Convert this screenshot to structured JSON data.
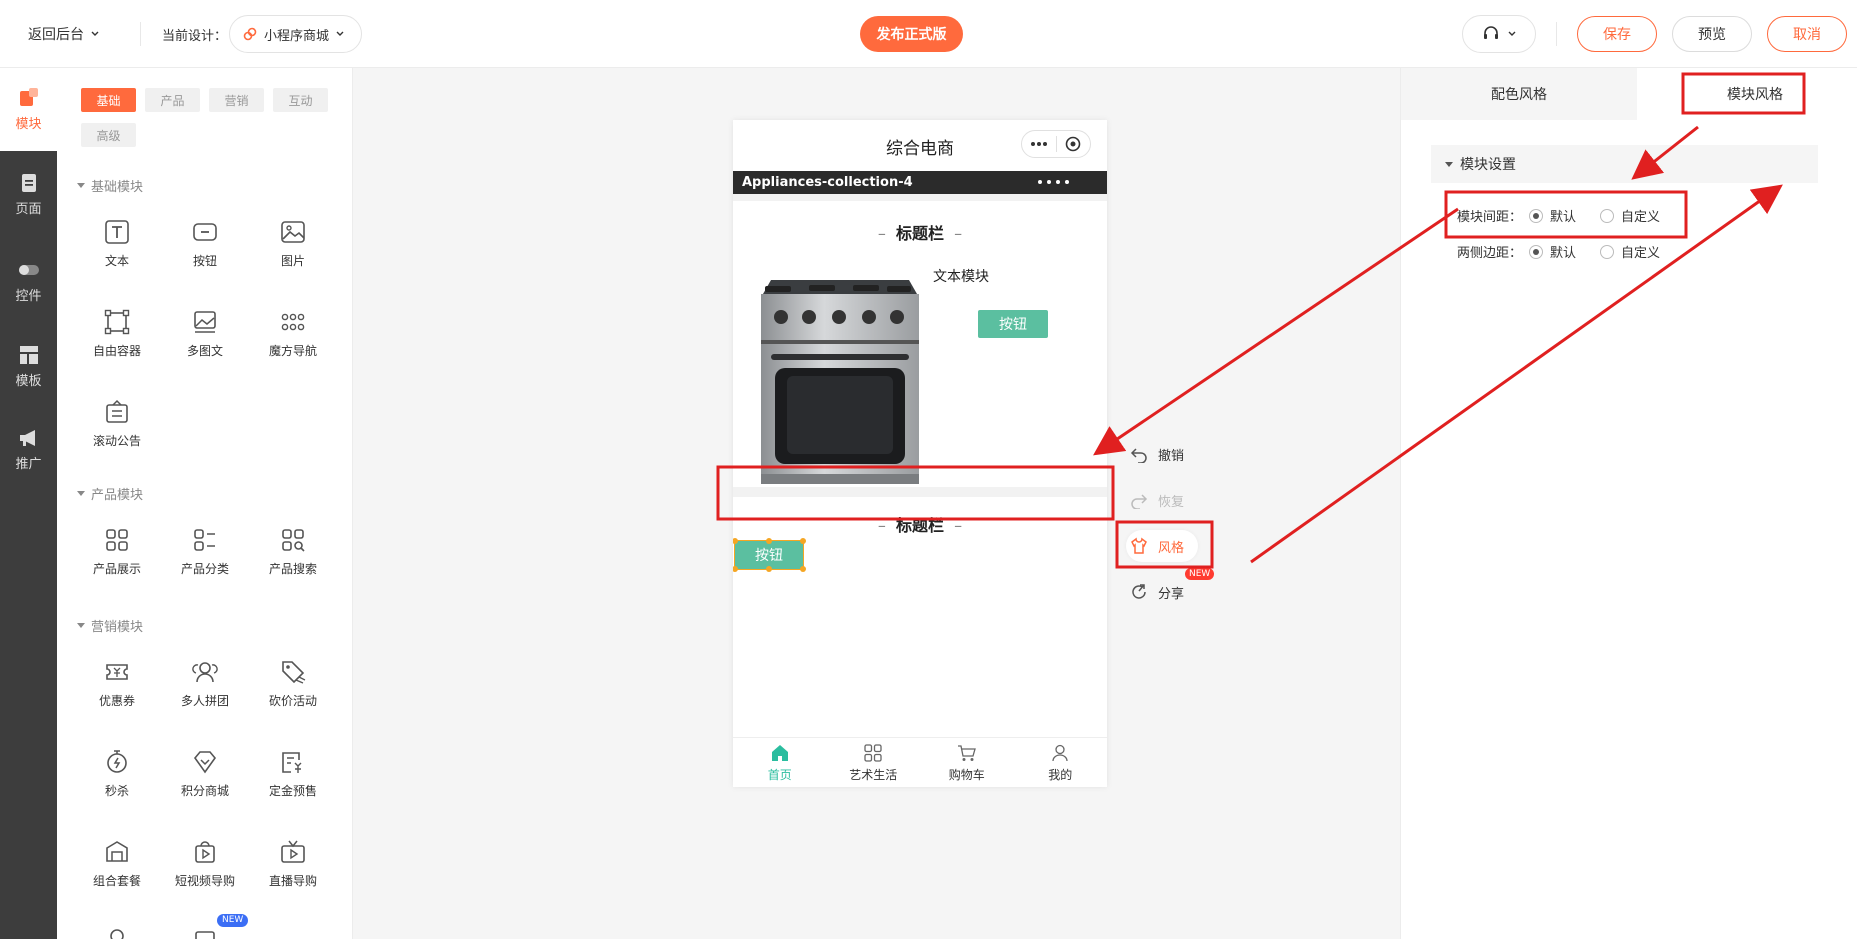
{
  "topbar": {
    "back_label": "返回后台",
    "current_design_label": "当前设计：",
    "design_name": "小程序商城",
    "publish_label": "发布正式版",
    "save_label": "保存",
    "preview_label": "预览",
    "cancel_label": "取消"
  },
  "leftnav": {
    "items": [
      {
        "label": "模块",
        "icon": "module-icon"
      },
      {
        "label": "页面",
        "icon": "page-icon"
      },
      {
        "label": "控件",
        "icon": "toggle-icon"
      },
      {
        "label": "模板",
        "icon": "template-icon"
      },
      {
        "label": "推广",
        "icon": "megaphone-icon"
      }
    ]
  },
  "components": {
    "tabs": [
      "基础",
      "产品",
      "营销",
      "互动",
      "高级"
    ],
    "sections": [
      {
        "title": "基础模块",
        "items": [
          "文本",
          "按钮",
          "图片",
          "自由容器",
          "多图文",
          "魔方导航",
          "滚动公告"
        ]
      },
      {
        "title": "产品模块",
        "items": [
          "产品展示",
          "产品分类",
          "产品搜索"
        ]
      },
      {
        "title": "营销模块",
        "items": [
          "优惠券",
          "多人拼团",
          "砍价活动",
          "秒杀",
          "积分商城",
          "定金预售",
          "组合套餐",
          "短视频导购",
          "直播导购"
        ]
      }
    ],
    "new_badge": "NEW"
  },
  "phone": {
    "title": "综合电商",
    "band_title": "Appliances-collection-4",
    "heading_1": "标题栏",
    "text_module": "文本模块",
    "button_1": "按钮",
    "heading_2": "标题栏",
    "button_2": "按钮",
    "tabs": [
      "首页",
      "艺术生活",
      "购物车",
      "我的"
    ]
  },
  "actions": {
    "undo": "撤销",
    "redo": "恢复",
    "style": "风格",
    "share": "分享",
    "new_badge": "NEW"
  },
  "rightpanel": {
    "tab_color": "配色风格",
    "tab_module": "模块风格",
    "section_title": "模块设置",
    "row1_label": "模块间距：",
    "row2_label": "两侧边距：",
    "opt_default": "默认",
    "opt_custom": "自定义"
  },
  "colors": {
    "accent": "#ff6a3d",
    "green_button": "#5bbfa0",
    "annotation_red": "#e02020"
  }
}
